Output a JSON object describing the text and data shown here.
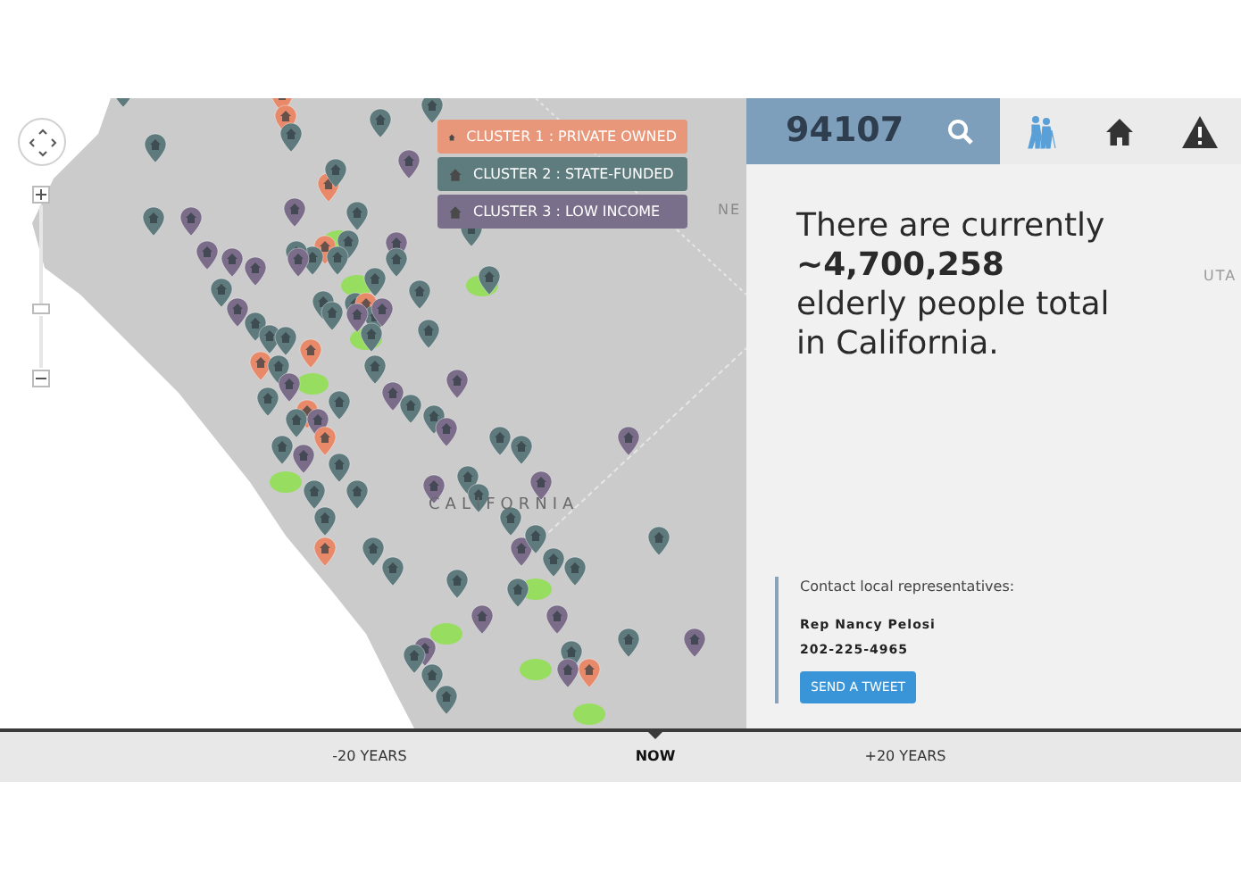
{
  "map": {
    "labels": [
      "NE",
      "CALIFORNIA"
    ],
    "legend": [
      {
        "label": "CLUSTER 1 : PRIVATE OWNED",
        "color": "#e9977a"
      },
      {
        "label": "CLUSTER 2 : STATE-FUNDED",
        "color": "#5e7c7e"
      },
      {
        "label": "CLUSTER 3 : LOW INCOME",
        "color": "#7a6f8a"
      }
    ]
  },
  "search": {
    "value": "94107"
  },
  "panel": {
    "lines": [
      "There are currently",
      "**~4,700,258**",
      "elderly people total",
      "in California."
    ],
    "faint_label": "UTA"
  },
  "contact": {
    "heading": "Contact local representatives:",
    "name": "Rep Nancy Pelosi",
    "phone": "202-225-4965",
    "button": "SEND A TWEET"
  },
  "timeline": [
    {
      "label": "-20 YEARS",
      "selected": false
    },
    {
      "label": "NOW",
      "selected": true
    },
    {
      "label": "+20 YEARS",
      "selected": false
    }
  ]
}
